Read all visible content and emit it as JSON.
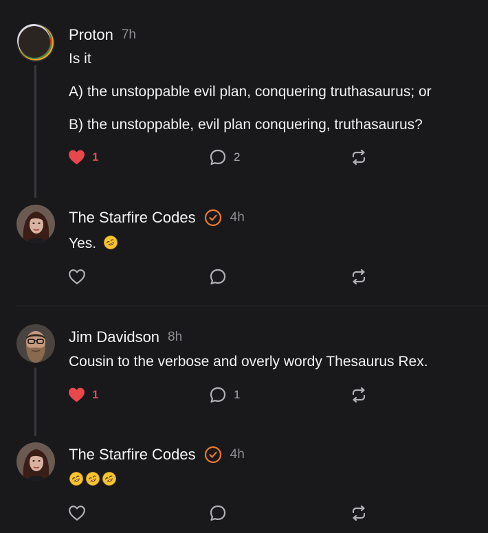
{
  "posts": [
    {
      "author": "Proton",
      "time": "7h",
      "lines": [
        "Is it",
        "A) the unstoppable evil plan, conquering truthasaurus; or",
        "B) the unstoppable, evil plan conquering, truthasaurus?"
      ],
      "likes": "1",
      "liked": true,
      "replies": "2"
    },
    {
      "author": "The Starfire Codes",
      "time": "4h",
      "verified": true,
      "text": "Yes.",
      "emoji_count": 1,
      "likes": "",
      "replies": ""
    },
    {
      "author": "Jim Davidson",
      "time": "8h",
      "text": "Cousin to the verbose and overly wordy Thesaurus Rex.",
      "likes": "1",
      "liked": true,
      "replies": "1"
    },
    {
      "author": "The Starfire Codes",
      "time": "4h",
      "verified": true,
      "text": "",
      "emoji_count": 3,
      "likes": "",
      "replies": ""
    }
  ],
  "colors": {
    "background": "#19191b",
    "like_red": "#e8474b",
    "verified_orange": "#f07a2c",
    "icon_gray": "#b0b0b5"
  },
  "icons": {
    "like": "heart-icon",
    "reply": "speech-bubble-icon",
    "repost": "repost-icon",
    "verified": "verified-badge-icon",
    "emoji": "rolling-on-floor-laughing-emoji"
  }
}
